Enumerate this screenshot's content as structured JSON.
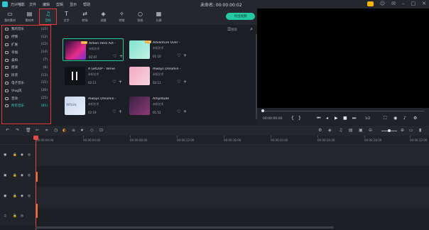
{
  "app": {
    "name": "万兴喵影",
    "menu": [
      "文件",
      "编辑",
      "剪辑",
      "显示",
      "帮助"
    ],
    "title": "未命名: 00:00:00:02"
  },
  "toolbar": {
    "tabs": [
      {
        "label": "我的素材",
        "icon": "folder-icon"
      },
      {
        "label": "素材库",
        "icon": "library-icon"
      },
      {
        "label": "音频",
        "icon": "music-note-icon"
      },
      {
        "label": "文字",
        "icon": "text-icon"
      },
      {
        "label": "转场",
        "icon": "transition-icon"
      },
      {
        "label": "滤镜",
        "icon": "filter-icon"
      },
      {
        "label": "特效",
        "icon": "effects-icon"
      },
      {
        "label": "贴纸",
        "icon": "sticker-icon"
      },
      {
        "label": "分屏",
        "icon": "split-screen-icon"
      }
    ],
    "export_label": "导出视频"
  },
  "sidebar": {
    "items": [
      {
        "label": "我的音乐",
        "count": "(15)"
      },
      {
        "label": "抒情",
        "count": "(12)"
      },
      {
        "label": "扩展",
        "count": "(12)"
      },
      {
        "label": "幸福",
        "count": "(14)"
      },
      {
        "label": "柔和",
        "count": "(7)"
      },
      {
        "label": "摇滚",
        "count": "(6)"
      },
      {
        "label": "民谣",
        "count": "(13)"
      },
      {
        "label": "电子音乐",
        "count": "(11)"
      },
      {
        "label": "Vlog风",
        "count": "(20)"
      },
      {
        "label": "音效",
        "count": "(25)"
      },
      {
        "label": "所有音乐",
        "count": "(85)"
      }
    ]
  },
  "search": {
    "placeholder": "搜索"
  },
  "cards": [
    {
      "title": "Action Hero Act -",
      "artist": "未知艺术",
      "duration": "02:07",
      "badge": "free"
    },
    {
      "title": "Adventure Over -",
      "artist": "未知艺术",
      "duration": "01:10",
      "badge": "free"
    },
    {
      "title": "A GROUP - Verve",
      "artist": "未知艺术",
      "duration": "02:11",
      "badge": ""
    },
    {
      "title": "Always Dreamin -",
      "artist": "未知艺术",
      "duration": "02:13",
      "badge": ""
    },
    {
      "title": "Always Dreamin -",
      "artist": "未知艺术",
      "duration": "02:19",
      "badge": ""
    },
    {
      "title": "Amplitude",
      "artist": "未知艺术",
      "duration": "01:52",
      "badge": ""
    }
  ],
  "player": {
    "current_time": "00:00:00:00",
    "zoom": "1/2",
    "progress": 0
  },
  "ruler": [
    "00:00:00:00",
    "00:00:04:00",
    "00:00:08:00",
    "00:00:12:00",
    "00:00:16:00",
    "00:00:20:00",
    "00:00:24:00",
    "00:00:28:00",
    "00:00:32:00"
  ],
  "accent": "#22c9a2",
  "highlight": "#e03b3b"
}
